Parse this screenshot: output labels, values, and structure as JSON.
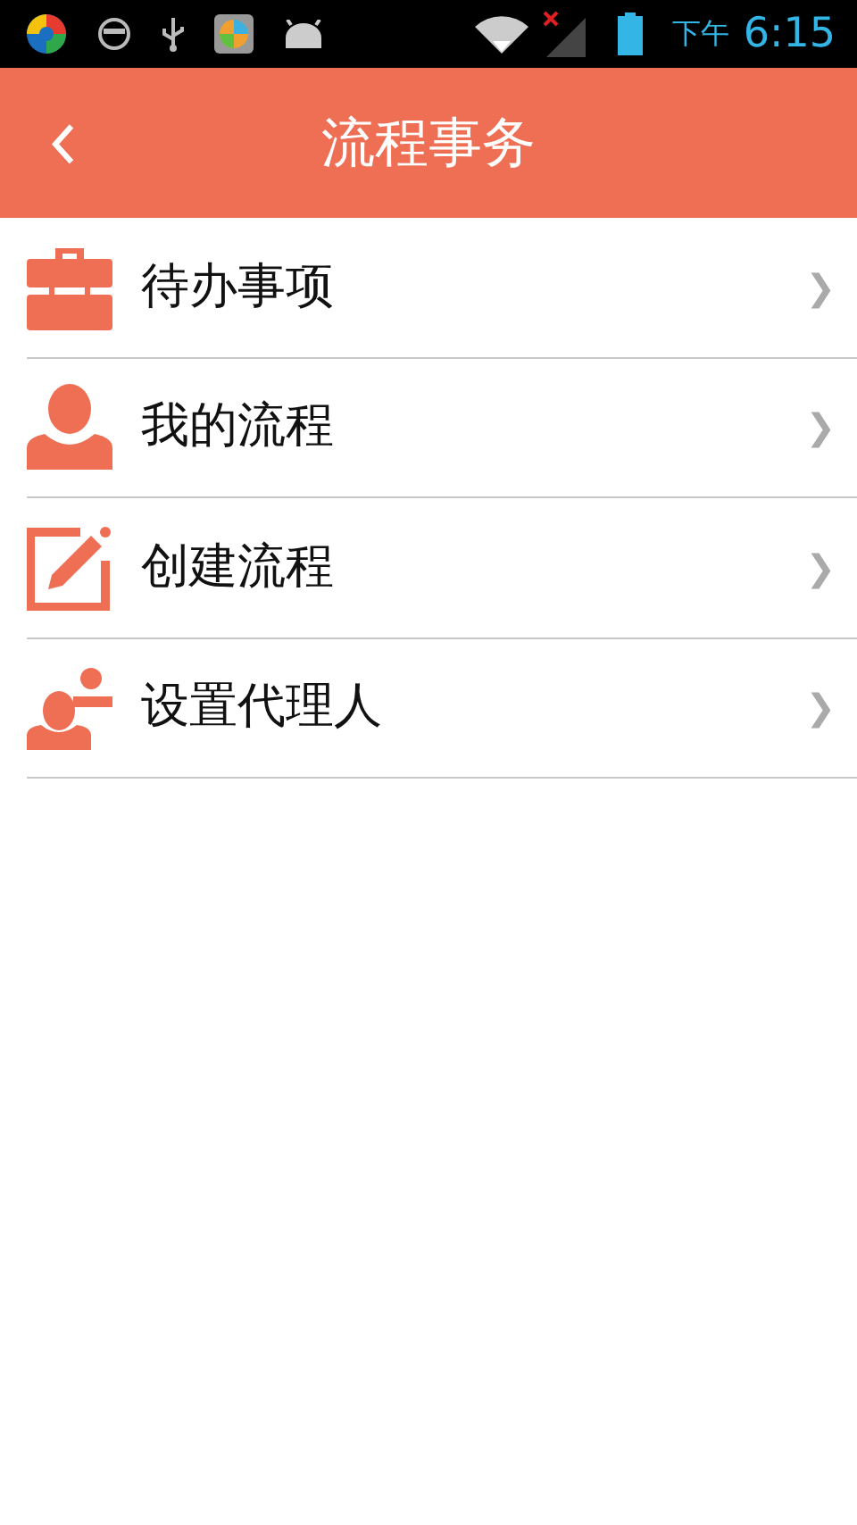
{
  "status_bar": {
    "period": "下午",
    "time": "6:15"
  },
  "header": {
    "title": "流程事务"
  },
  "items": [
    {
      "kind": "briefcase",
      "label": "待办事项",
      "chevron": "❯"
    },
    {
      "kind": "person",
      "label": "我的流程",
      "chevron": "❯"
    },
    {
      "kind": "edit",
      "label": "创建流程",
      "chevron": "❯"
    },
    {
      "kind": "agent",
      "label": "设置代理人",
      "chevron": "❯"
    }
  ]
}
